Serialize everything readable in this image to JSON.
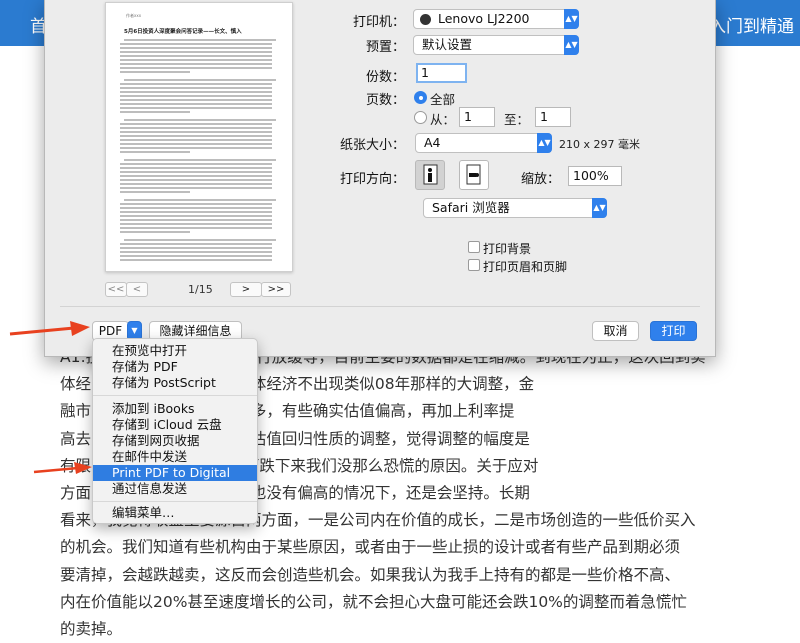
{
  "website": {
    "header_left": "首",
    "header_right": "入门到精通",
    "paragraphs": [
      "A1:投资这主要是由于经济运行放缓等，目前主要的数据都是在缩减。到现在为止，这次回到实",
      "体经          在目前的点位，只要实体经济不出现类似08年那样的大调整，金",
      "融市          近两年有些股票涨了很多，有些确实估值偏高，再加上利率提",
      "高去          近的回调我更多认为是估值回归性质的调整，觉得调整的幅度是",
      "有限          这也是为什么3500点下跌下来我们没那么恐慌的原因。关于应对",
      "方面          注风险，同时股票估值也没有偏高的情况下，还是会坚持。长期",
      "看来，我觉得收益主要源自两方面，一是公司内在价值的成长，二是市场创造的一些低价买入",
      "的机会。我们知道有些机构由于某些原因，或者由于一些止损的设计或者有些产品到期必须",
      "要清掉，会越跌越卖，这反而会创造些机会。如果我认为我手上持有的都是一些价格不高、",
      "内在价值能以20%甚至速度增长的公司，就不会担心大盘可能还会跌10%的调整而着急慌忙",
      "的卖掉。"
    ]
  },
  "preview": {
    "author": "作者xxx",
    "title": "5月6日投资人深度聚会问答记录——长文、慎入",
    "page_indicator": "1/15",
    "nav_first": "<<",
    "nav_prev": "<",
    "nav_next": ">",
    "nav_last": ">>"
  },
  "settings": {
    "printer_label": "打印机：",
    "printer_value": "Lenovo LJ2200",
    "preset_label": "预置：",
    "preset_value": "默认设置",
    "copies_label": "份数：",
    "copies_value": "1",
    "pages_label": "页数：",
    "pages_all": "全部",
    "pages_from": "从：",
    "pages_from_value": "1",
    "pages_to": "至：",
    "pages_to_value": "1",
    "paper_label": "纸张大小：",
    "paper_value": "A4",
    "paper_dims": "210 x 297 毫米",
    "orientation_label": "打印方向：",
    "scale_label": "缩放：",
    "scale_value": "100%",
    "app_section": "Safari 浏览器",
    "print_backgrounds": "打印背景",
    "print_headers_footers": "打印页眉和页脚"
  },
  "buttons": {
    "pdf": "PDF",
    "hide_details": "隐藏详细信息",
    "cancel": "取消",
    "print": "打印"
  },
  "pdf_menu": {
    "items": [
      "在预览中打开",
      "存储为 PDF",
      "存储为 PostScript",
      "添加到 iBooks",
      "存储到 iCloud 云盘",
      "存储到网页收据",
      "在邮件中发送",
      "Print PDF to Digital Paper",
      "通过信息发送",
      "编辑菜单…"
    ],
    "selected": "Print PDF to Digital Paper"
  },
  "colors": {
    "accent": "#2f80ec",
    "header_bg": "#2b7bd0",
    "annotation_arrow": "#e8411f"
  }
}
